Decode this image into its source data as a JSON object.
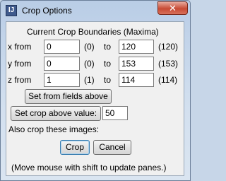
{
  "window": {
    "title": "Crop Options",
    "icon": "imagej-icon",
    "close_label": "✕"
  },
  "header": "Current Crop Boundaries (Maxima)",
  "rows": [
    {
      "from_label": "x from",
      "from_value": "0",
      "min_hint": "(0)",
      "to_label": "to",
      "to_value": "120",
      "max_hint": "(120)"
    },
    {
      "from_label": "y from",
      "from_value": "0",
      "min_hint": "(0)",
      "to_label": "to",
      "to_value": "153",
      "max_hint": "(153)"
    },
    {
      "from_label": "z from",
      "from_value": "1",
      "min_hint": "(1)",
      "to_label": "to",
      "to_value": "114",
      "max_hint": "(114)"
    }
  ],
  "set_from_fields_label": "Set from fields above",
  "set_crop_above_label": "Set crop above value:",
  "crop_above_value": "50",
  "also_crop_label": "Also crop these images:",
  "crop_label": "Crop",
  "cancel_label": "Cancel",
  "hint": "(Move mouse with shift to update panes.)"
}
